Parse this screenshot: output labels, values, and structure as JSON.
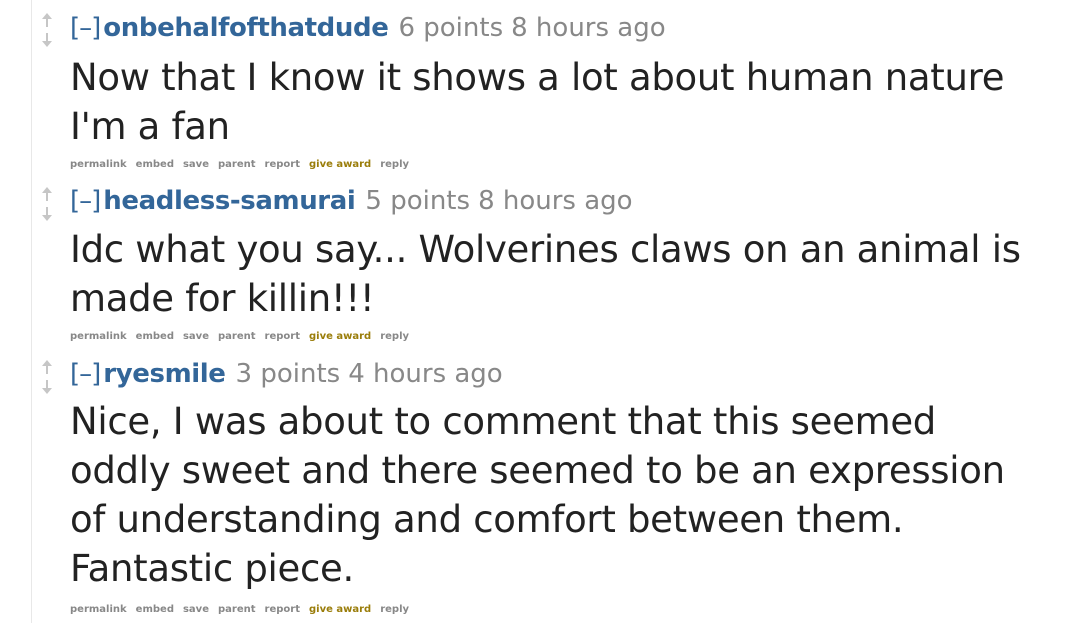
{
  "comments": [
    {
      "expand": "[–]",
      "author": "onbehalfofthatdude",
      "score": "6 points",
      "time": "8 hours ago",
      "body": "Now that I know it shows a lot about human nature I'm a fan"
    },
    {
      "expand": "[–]",
      "author": "headless-samurai",
      "score": "5 points",
      "time": "8 hours ago",
      "body": "Idc what you say... Wolverines claws on an animal is made for killin!!!"
    },
    {
      "expand": "[–]",
      "author": "ryesmile",
      "score": "3 points",
      "time": "4 hours ago",
      "body": "Nice, I was about to comment that this seemed oddly sweet and there seemed to be an expression of understanding and comfort between them. Fantastic piece."
    }
  ],
  "actions": {
    "permalink": "permalink",
    "embed": "embed",
    "save": "save",
    "parent": "parent",
    "report": "report",
    "give_award": "give award",
    "reply": "reply"
  },
  "icons": {
    "upvote": "upvote-arrow-icon",
    "downvote": "downvote-arrow-icon"
  },
  "colors": {
    "author": "#336699",
    "meta": "#888888",
    "body": "#222222",
    "award": "#9a7d0a",
    "vote_icon": "#c6c6c6"
  }
}
